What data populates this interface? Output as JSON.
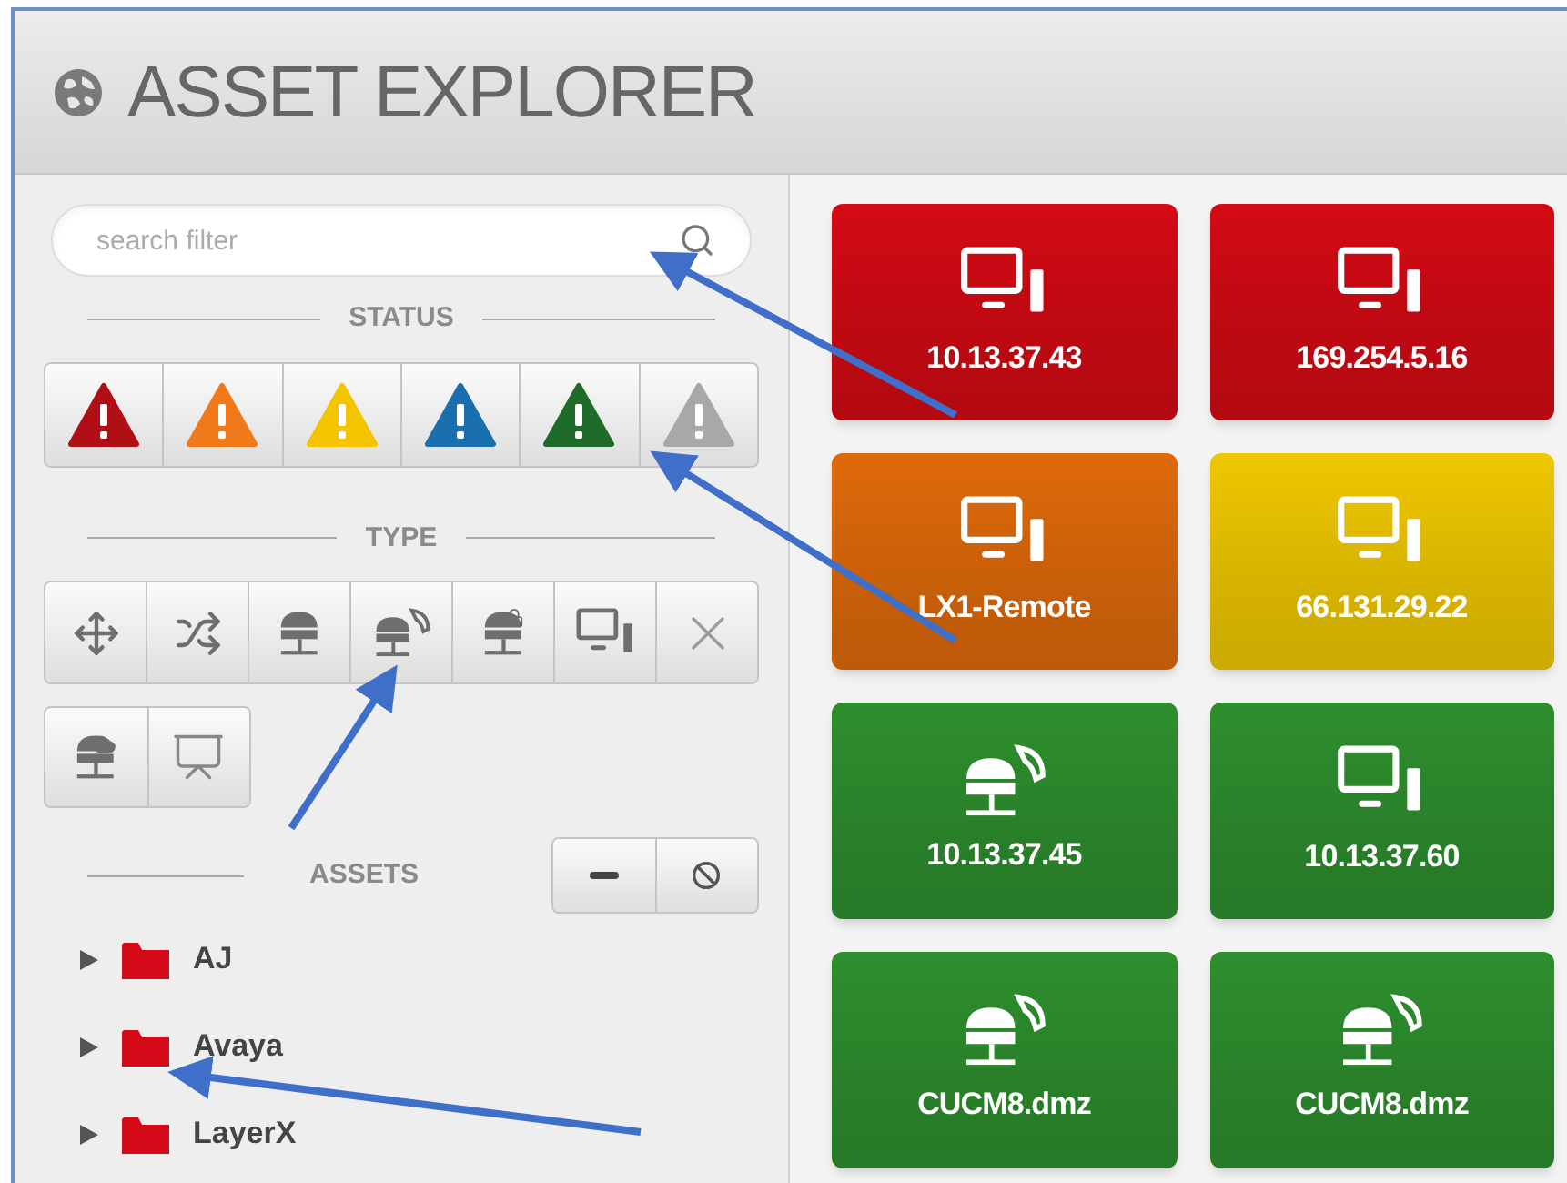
{
  "window": {
    "title": "ASSET EXPLORER"
  },
  "search": {
    "placeholder": "search filter"
  },
  "status": {
    "label": "STATUS",
    "filters": [
      {
        "color": "#b01015"
      },
      {
        "color": "#f07a1a"
      },
      {
        "color": "#f5c400"
      },
      {
        "color": "#1a6fae"
      },
      {
        "color": "#1f6b2a"
      },
      {
        "color": "#a8a8a8"
      }
    ]
  },
  "type": {
    "label": "TYPE",
    "filters": [
      {
        "kind": "move"
      },
      {
        "kind": "shuffle"
      },
      {
        "kind": "server"
      },
      {
        "kind": "phone-server"
      },
      {
        "kind": "locked-server"
      },
      {
        "kind": "computer"
      },
      {
        "kind": "x"
      },
      {
        "kind": "cloud-server"
      },
      {
        "kind": "presentation"
      }
    ]
  },
  "assets": {
    "label": "ASSETS",
    "buttons": [
      {
        "kind": "collapse"
      },
      {
        "kind": "block"
      }
    ],
    "tree": [
      {
        "name": "AJ",
        "expanded": false
      },
      {
        "name": "Avaya",
        "expanded": false
      },
      {
        "name": "LayerX",
        "expanded": false
      }
    ]
  },
  "tiles": [
    {
      "label": "10.13.37.43",
      "kind": "computer",
      "color": "#d40a14"
    },
    {
      "label": "169.254.5.16",
      "kind": "computer",
      "color": "#d40a14"
    },
    {
      "label": "LX1-Remote",
      "kind": "computer",
      "color": "#e06a0a"
    },
    {
      "label": "66.131.29.22",
      "kind": "computer",
      "color": "#f0c800"
    },
    {
      "label": "10.13.37.45",
      "kind": "phone-server",
      "color": "#2e8f2e"
    },
    {
      "label": "10.13.37.60",
      "kind": "computer",
      "color": "#2e8f2e"
    },
    {
      "label": "CUCM8.dmz",
      "kind": "phone-server",
      "color": "#2e8f2e"
    },
    {
      "label": "CUCM8.dmz",
      "kind": "phone-server",
      "color": "#2e8f2e"
    }
  ]
}
